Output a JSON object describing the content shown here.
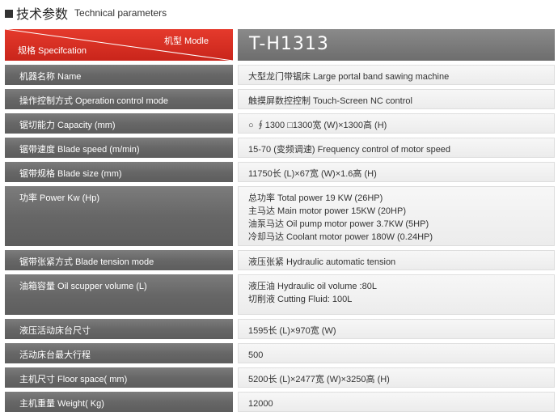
{
  "header": {
    "title_zh": "技术参数",
    "title_en": "Technical parameters"
  },
  "head": {
    "model_label": "机型 Modle",
    "spec_label": "规格 Specifcation",
    "model_value": "T-H1313"
  },
  "rows": [
    {
      "label": "机器名称 Name",
      "lines": [
        "大型龙门带锯床 Large portal band sawing machine"
      ]
    },
    {
      "label": "操作控制方式 Operation control mode",
      "lines": [
        "触摸屏数控控制 Touch-Screen NC control"
      ]
    },
    {
      "label": "锯切能力 Capacity (mm)",
      "lines": [
        "○ ∮1300    □1300宽 (W)×1300高 (H)"
      ]
    },
    {
      "label": "锯带速度 Blade speed (m/min)",
      "lines": [
        "15-70 (变频调速) Frequency control of motor speed"
      ]
    },
    {
      "label": "锯带规格 Blade size (mm)",
      "lines": [
        "11750长 (L)×67宽 (W)×1.6高 (H)"
      ]
    },
    {
      "label": "功率 Power Kw (Hp)",
      "lines": [
        "总功率 Total power 19 KW (26HP)",
        "主马达 Main motor power 15KW (20HP)",
        "油泵马达 Oil pump motor power 3.7KW (5HP)",
        "冷却马达 Coolant motor power 180W (0.24HP)"
      ]
    },
    {
      "label": "锯带张紧方式 Blade tension mode",
      "lines": [
        "液压张紧 Hydraulic automatic tension"
      ]
    },
    {
      "label": "油箱容量 Oil scupper volume (L)",
      "lines": [
        "液压油 Hydraulic oil volume :80L",
        "切削液 Cutting Fluid: 100L"
      ]
    },
    {
      "label": "液压活动床台尺寸",
      "lines": [
        "1595长 (L)×970宽 (W)"
      ]
    },
    {
      "label": "活动床台最大行程",
      "lines": [
        "500"
      ]
    },
    {
      "label": "主机尺寸 Floor space( mm)",
      "lines": [
        "5200长 (L)×2477宽 (W)×3250高 (H)"
      ]
    },
    {
      "label": "主机重量 Weight( Kg)",
      "lines": [
        "12000"
      ]
    }
  ]
}
